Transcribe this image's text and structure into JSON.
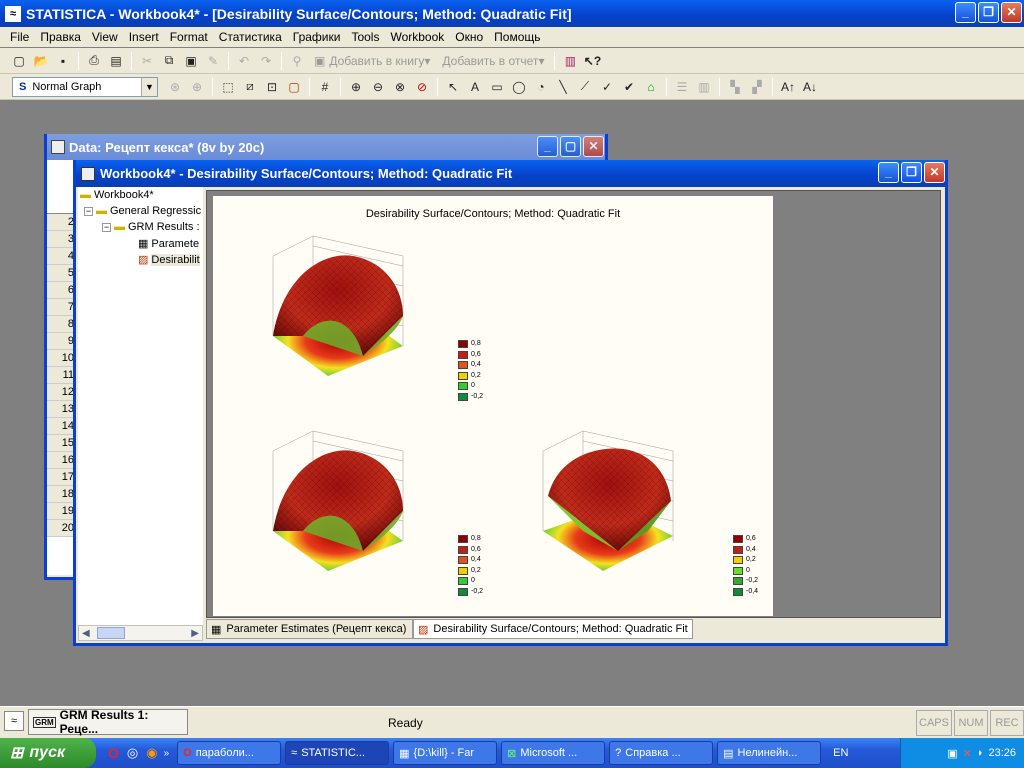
{
  "app": {
    "title": "STATISTICA - Workbook4* - [Desirability Surface/Contours; Method: Quadratic Fit]"
  },
  "menu": [
    "File",
    "Правка",
    "View",
    "Insert",
    "Format",
    "Статистика",
    "Графики",
    "Tools",
    "Workbook",
    "Окно",
    "Помощь"
  ],
  "toolbar1": {
    "add_to_book": "Добавить в книгу",
    "add_to_report": "Добавить в отчет"
  },
  "toolbar2": {
    "graph_style": "Normal Graph"
  },
  "data_window": {
    "title": "Data: Рецепт кекса* (8v by 20c)",
    "row_numbers": [
      "2",
      "3",
      "4",
      "5",
      "6",
      "7",
      "8",
      "9",
      "10",
      "11",
      "12",
      "13",
      "14",
      "15",
      "16",
      "17",
      "18",
      "19",
      "20"
    ]
  },
  "workbook": {
    "title": "Workbook4* - Desirability Surface/Contours; Method: Quadratic Fit",
    "tree": [
      "Workbook4*",
      "General Regressic",
      "GRM Results :",
      "Paramete",
      "Desirabilit"
    ],
    "graph_title": "Desirability Surface/Contours; Method: Quadratic Fit",
    "tabs": [
      "Parameter Estimates (Рецепт кекса)",
      "Desirability Surface/Contours; Method: Quadratic Fit"
    ]
  },
  "legends": [
    {
      "labels": [
        "0,8",
        "0,6",
        "0,4",
        "0,2",
        "0",
        "-0,2"
      ],
      "colors": [
        "#8b0000",
        "#c0201a",
        "#e2521c",
        "#f0d000",
        "#33cc33",
        "#118b3a"
      ]
    },
    {
      "labels": [
        "0,8",
        "0,6",
        "0,4",
        "0,2",
        "0",
        "-0,2"
      ],
      "colors": [
        "#8b0000",
        "#c0201a",
        "#e2521c",
        "#f0d000",
        "#33cc33",
        "#118b3a"
      ]
    },
    {
      "labels": [
        "0,6",
        "0,4",
        "0,2",
        "0",
        "-0,2",
        "-0,4"
      ],
      "colors": [
        "#8b0000",
        "#c0201a",
        "#f0d000",
        "#66dd33",
        "#33aa33",
        "#118b3a"
      ]
    }
  ],
  "status": {
    "left_item": "GRM Results 1: Реце...",
    "text": "Ready",
    "caps": "CAPS",
    "num": "NUM",
    "rec": "REC"
  },
  "taskbar": {
    "start": "пуск",
    "tasks": [
      "параболи...",
      "STATISTIC...",
      "{D:\\kill} - Far",
      "Microsoft ...",
      "Справка ...",
      "Нелинейн..."
    ],
    "lang": "EN",
    "clock": "23:26"
  }
}
